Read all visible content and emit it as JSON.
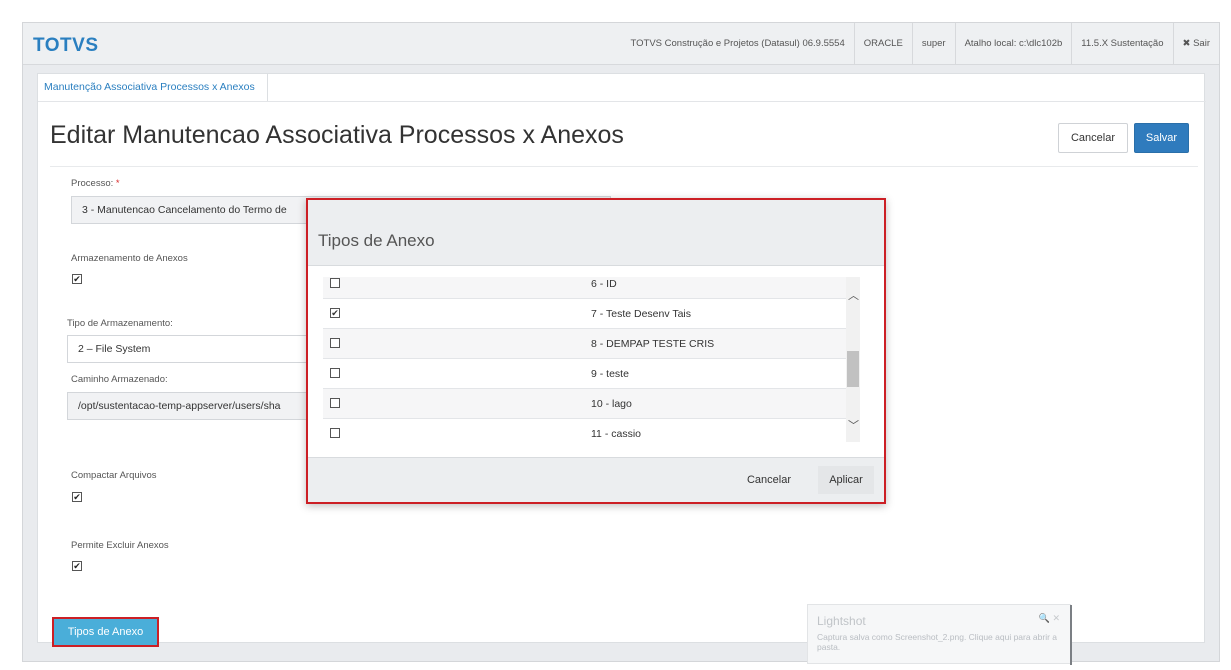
{
  "header": {
    "logo": "TOTVS",
    "items": [
      "TOTVS Construção e Projetos (Datasul) 06.9.5554",
      "ORACLE",
      "super",
      "Atalho local: c:\\dlc102b",
      "11.5.X Sustentação"
    ],
    "exit_label": "✖ Sair"
  },
  "breadcrumb": {
    "item": "Manutenção Associativa Processos x Anexos"
  },
  "page": {
    "title": "Editar Manutencao Associativa Processos x Anexos",
    "cancel_label": "Cancelar",
    "save_label": "Salvar"
  },
  "form": {
    "processo_label": "Processo:",
    "processo_required": "*",
    "processo_value": "3 - Manutencao Cancelamento do Termo de",
    "armazenamento_label": "Armazenamento de Anexos",
    "armazenamento_checked": "✔",
    "tipo_label": "Tipo de Armazenamento:",
    "tipo_value": "2 – File System",
    "caminho_label": "Caminho Armazenado:",
    "caminho_value": "/opt/sustentacao-temp-appserver/users/sha",
    "compactar_label": "Compactar Arquivos",
    "compactar_checked": "✔",
    "permite_label": "Permite Excluir Anexos",
    "permite_checked": "✔",
    "tipos_button": "Tipos de Anexo"
  },
  "modal": {
    "title": "Tipos de Anexo",
    "rows": [
      {
        "label": "6 - ID",
        "check": ""
      },
      {
        "label": "7 - Teste Desenv Tais",
        "check": "✔"
      },
      {
        "label": "8 - DEMPAP TESTE CRIS",
        "check": ""
      },
      {
        "label": "9 - teste",
        "check": ""
      },
      {
        "label": "10 - lago",
        "check": ""
      },
      {
        "label": "11 - cassio",
        "check": ""
      }
    ],
    "scroll_up": "︿",
    "scroll_down": "﹀",
    "cancel_label": "Cancelar",
    "apply_label": "Aplicar"
  },
  "lightshot": {
    "title": "Lightshot",
    "message": "Captura salva como Screenshot_2.png. Clique aqui para abrir a pasta.",
    "close": "🔍 ✕"
  }
}
